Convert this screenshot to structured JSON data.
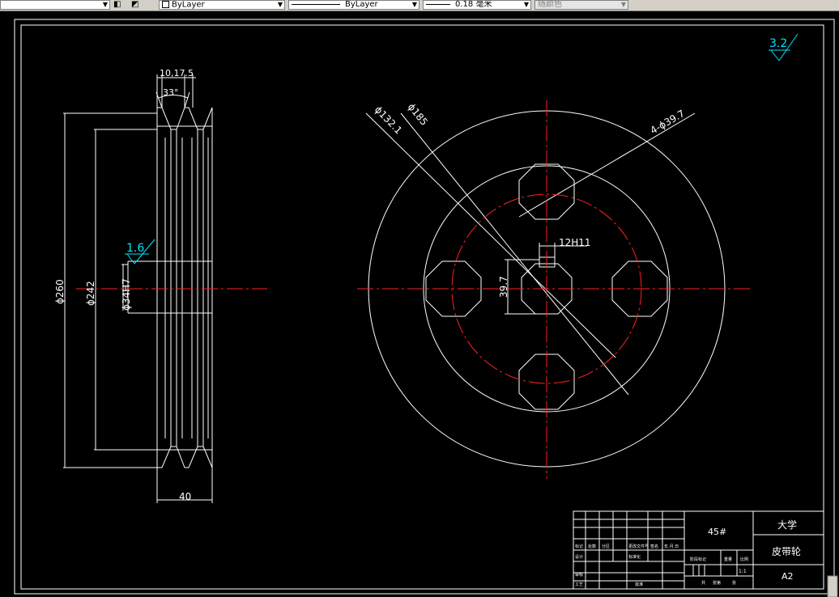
{
  "toolbar": {
    "layer_combo": "ByLayer",
    "linetype_combo": "ByLayer",
    "lineweight_combo": "0.18 毫米",
    "color_combo": "随颜色"
  },
  "drawing": {
    "roughness_main": "3.2",
    "roughness_bore": "1.6",
    "dim_width_top": "10,17.5",
    "dim_angle": "33°",
    "dim_outer_dia": "ϕ260",
    "dim_rim_dia": "ϕ242",
    "dim_bore": "ϕ34H7",
    "dim_hub_width": "40",
    "dim_bolt_circle": "ϕ132.1",
    "dim_dia_185": "ϕ185",
    "dim_holes": "4-ϕ39.7",
    "dim_keyway_width": "12H11",
    "dim_keyway_depth": "39.7"
  },
  "title_block": {
    "material": "45#",
    "school": "大学",
    "part_name": "皮带轮",
    "sheet_size": "A2",
    "scale": "1:1",
    "small_labels": [
      "标记",
      "处数",
      "分区",
      "更改文件号",
      "签名",
      "年.月.日",
      "设计",
      "标准化",
      "阶段标记",
      "重量",
      "比例",
      "审核",
      "工艺",
      "批准",
      "共",
      "张第",
      "张"
    ]
  },
  "colors": {
    "background": "#000000",
    "line": "#ffffff",
    "centerline": "#ff2020",
    "annotation": "#00e5ff"
  }
}
